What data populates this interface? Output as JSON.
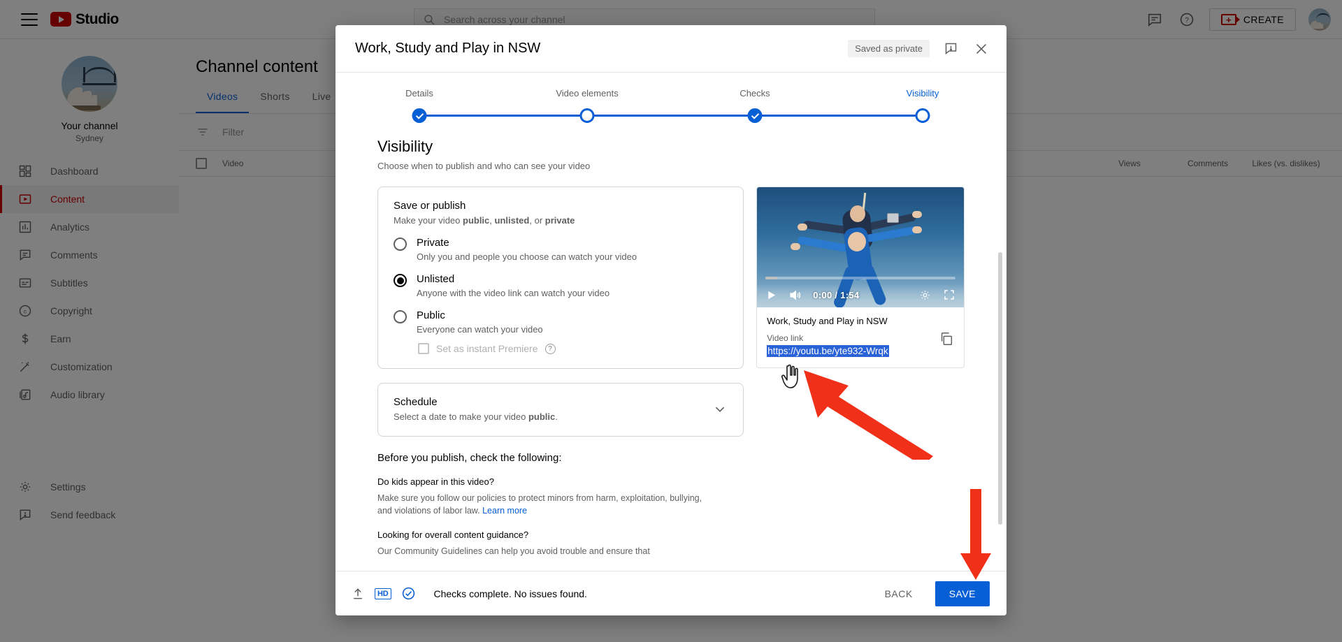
{
  "topbar": {
    "menu_icon": "hamburger-icon",
    "logo_text": "Studio",
    "search_placeholder": "Search across your channel",
    "feedback_icon": "feedback-icon",
    "help_icon": "help-icon",
    "create_label": "CREATE"
  },
  "sidebar": {
    "channel_name": "Your channel",
    "channel_subtitle": "Sydney",
    "items": [
      {
        "label": "Dashboard",
        "icon": "dashboard-icon",
        "active": false
      },
      {
        "label": "Content",
        "icon": "content-video-icon",
        "active": true
      },
      {
        "label": "Analytics",
        "icon": "analytics-icon",
        "active": false
      },
      {
        "label": "Comments",
        "icon": "comments-icon",
        "active": false
      },
      {
        "label": "Subtitles",
        "icon": "subtitles-icon",
        "active": false
      },
      {
        "label": "Copyright",
        "icon": "copyright-icon",
        "active": false
      },
      {
        "label": "Earn",
        "icon": "dollar-icon",
        "active": false
      },
      {
        "label": "Customization",
        "icon": "magic-wand-icon",
        "active": false
      },
      {
        "label": "Audio library",
        "icon": "audio-library-icon",
        "active": false
      }
    ],
    "bottom_items": [
      {
        "label": "Settings",
        "icon": "gear-icon"
      },
      {
        "label": "Send feedback",
        "icon": "feedback-icon"
      }
    ]
  },
  "page": {
    "title": "Channel content",
    "tabs": [
      {
        "label": "Videos",
        "active": true
      },
      {
        "label": "Shorts",
        "active": false
      },
      {
        "label": "Live",
        "active": false
      }
    ],
    "filter_label": "Filter",
    "table_headers": {
      "video": "Video",
      "views": "Views",
      "comments": "Comments",
      "likes": "Likes (vs. dislikes)"
    }
  },
  "modal": {
    "title": "Work, Study and Play in NSW",
    "status_badge": "Saved as private",
    "report_icon": "report-problem-icon",
    "close_icon": "close-icon",
    "steps": [
      {
        "label": "Details",
        "state": "done"
      },
      {
        "label": "Video elements",
        "state": "open"
      },
      {
        "label": "Checks",
        "state": "done"
      },
      {
        "label": "Visibility",
        "state": "open",
        "current": true
      }
    ],
    "section": {
      "title": "Visibility",
      "subtitle": "Choose when to publish and who can see your video"
    },
    "save_or_publish": {
      "title": "Save or publish",
      "subtitle_prefix": "Make your video ",
      "subtitle_b1": "public",
      "subtitle_mid1": ", ",
      "subtitle_b2": "unlisted",
      "subtitle_mid2": ", or ",
      "subtitle_b3": "private",
      "options": [
        {
          "label": "Private",
          "desc": "Only you and people you choose can watch your video",
          "selected": false
        },
        {
          "label": "Unlisted",
          "desc": "Anyone with the video link can watch your video",
          "selected": true
        },
        {
          "label": "Public",
          "desc": "Everyone can watch your video",
          "selected": false
        }
      ],
      "premiere_label": "Set as instant Premiere",
      "premiere_help_icon": "help-icon",
      "premiere_checked": false,
      "premiere_disabled": true
    },
    "schedule": {
      "title": "Schedule",
      "desc_prefix": "Select a date to make your video ",
      "desc_bold": "public",
      "desc_suffix": ".",
      "expand_icon": "chevron-down-icon"
    },
    "before_publish": {
      "heading": "Before you publish, check the following:",
      "items": [
        {
          "question": "Do kids appear in this video?",
          "body": "Make sure you follow our policies to protect minors from harm, exploitation, bullying, and violations of labor law.",
          "link": "Learn more"
        },
        {
          "question": "Looking for overall content guidance?",
          "body": "Our Community Guidelines can help you avoid trouble and ensure that",
          "link": ""
        }
      ]
    },
    "preview": {
      "play_icon": "play-icon",
      "volume_icon": "volume-icon",
      "time": "0:00 / 1:54",
      "settings_icon": "gear-icon",
      "fullscreen_icon": "fullscreen-icon",
      "video_title": "Work, Study and Play in NSW",
      "link_label": "Video link",
      "link_value": "https://youtu.be/yte932-Wrqk",
      "copy_icon": "copy-icon"
    },
    "footer": {
      "upload_icon": "upload-icon",
      "hd_badge": "HD",
      "check_icon": "check-circle-icon",
      "status": "Checks complete. No issues found.",
      "back_label": "BACK",
      "save_label": "SAVE"
    }
  },
  "annotations": {
    "arrow_color": "#f03018",
    "cursor_icon": "pointer-hand-cursor",
    "arrow_to_link": "arrow-pointing-to-video-link",
    "arrow_to_save": "arrow-pointing-to-save-button"
  },
  "colors": {
    "accent_blue": "#065fd4",
    "brand_red": "#c00",
    "selection_blue": "#2a62d8",
    "annotation_red": "#f03018"
  }
}
